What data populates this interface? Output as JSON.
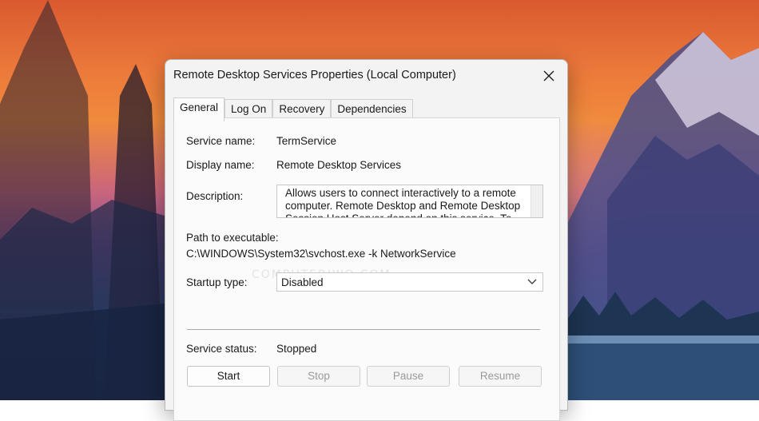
{
  "window": {
    "title": "Remote Desktop Services Properties (Local Computer)"
  },
  "tabs": [
    {
      "label": "General",
      "active": true
    },
    {
      "label": "Log On",
      "active": false
    },
    {
      "label": "Recovery",
      "active": false
    },
    {
      "label": "Dependencies",
      "active": false
    }
  ],
  "general": {
    "service_name_label": "Service name:",
    "service_name_value": "TermService",
    "display_name_label": "Display name:",
    "display_name_value": "Remote Desktop Services",
    "description_label": "Description:",
    "description_value": "Allows users to connect interactively to a remote computer. Remote Desktop and Remote Desktop Session Host Server depend on this service. To",
    "path_label": "Path to executable:",
    "path_value": "C:\\WINDOWS\\System32\\svchost.exe -k NetworkService",
    "startup_type_label": "Startup type:",
    "startup_type_value": "Disabled",
    "service_status_label": "Service status:",
    "service_status_value": "Stopped"
  },
  "buttons": {
    "start": "Start",
    "stop": "Stop",
    "pause": "Pause",
    "resume": "Resume"
  },
  "watermark": "COMPUTERIWO.COM",
  "icons": {
    "close": "close-icon",
    "dropdown": "chevron-down-icon"
  }
}
